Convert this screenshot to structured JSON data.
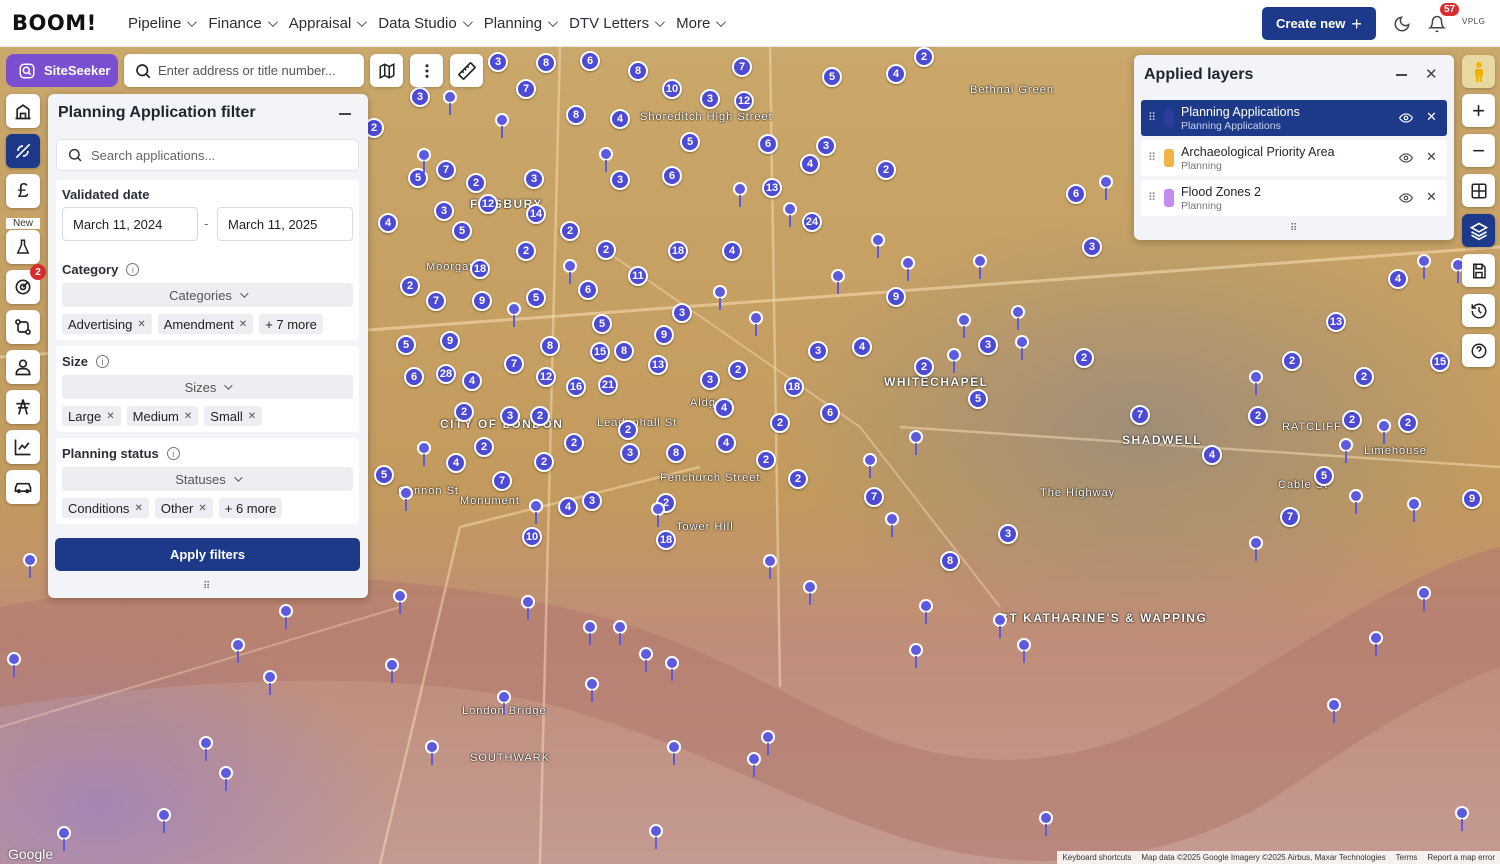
{
  "app": {
    "logo": "BOOM!"
  },
  "nav": {
    "items": [
      {
        "label": "Pipeline"
      },
      {
        "label": "Finance"
      },
      {
        "label": "Appraisal"
      },
      {
        "label": "Data Studio"
      },
      {
        "label": "Planning"
      },
      {
        "label": "DTV Letters"
      },
      {
        "label": "More"
      }
    ]
  },
  "header": {
    "create_label": "Create new",
    "notification_count": "57",
    "user_mark": "VPLG"
  },
  "toolbar": {
    "siteseeker_label": "SiteSeeker",
    "search_placeholder": "Enter address or title number..."
  },
  "sidebar": {
    "new_label": "New",
    "badge_count": "2"
  },
  "filter": {
    "title": "Planning Application filter",
    "search_placeholder": "Search applications...",
    "validated_date_label": "Validated date",
    "date_from": "March 11, 2024",
    "date_to": "March 11, 2025",
    "category_label": "Category",
    "category_dropdown": "Categories",
    "category_chips": [
      "Advertising",
      "Amendment"
    ],
    "category_more": "+ 7 more",
    "size_label": "Size",
    "size_dropdown": "Sizes",
    "size_chips": [
      "Large",
      "Medium",
      "Small"
    ],
    "status_label": "Planning status",
    "status_dropdown": "Statuses",
    "status_chips": [
      "Conditions",
      "Other"
    ],
    "status_more": "+ 6 more",
    "apply_label": "Apply filters"
  },
  "layers": {
    "title": "Applied layers",
    "items": [
      {
        "name": "Planning Applications",
        "sub": "Planning Applications",
        "color": "#2a3d9a"
      },
      {
        "name": "Archaeological Priority Area",
        "sub": "Planning",
        "color": "#f1b248"
      },
      {
        "name": "Flood Zones 2",
        "sub": "Planning",
        "color": "#c58cf0"
      }
    ]
  },
  "map": {
    "labels": [
      "FINSBURY",
      "WHITECHAPEL",
      "SHADWELL",
      "RATCLIFF",
      "ST KATHARINE'S & WAPPING",
      "CITY OF LONDON",
      "SOUTHWARK",
      "Moorgate",
      "Leadenhall St",
      "Cannon St",
      "Fenchurch Street",
      "Monument",
      "Aldgate",
      "Cable St",
      "The Highway",
      "Bethnal Green",
      "Shoreditch High Street",
      "Limehouse",
      "London Bridge",
      "Tower Hill"
    ],
    "clusters": [
      "3",
      "8",
      "6",
      "8",
      "7",
      "5",
      "4",
      "2",
      "7",
      "3",
      "12",
      "10",
      "3",
      "4",
      "8",
      "5",
      "3",
      "6",
      "2",
      "7",
      "5",
      "2",
      "3",
      "3",
      "6",
      "4",
      "2",
      "3",
      "12",
      "14",
      "5",
      "4",
      "2",
      "2",
      "2",
      "11",
      "18",
      "4",
      "13",
      "24",
      "2",
      "7",
      "9",
      "5",
      "6",
      "18",
      "5",
      "9",
      "3",
      "8",
      "8",
      "15",
      "9",
      "5",
      "6",
      "28",
      "4",
      "7",
      "12",
      "16",
      "21",
      "13",
      "3",
      "2",
      "18",
      "3",
      "4",
      "2",
      "3",
      "2",
      "2",
      "4",
      "2",
      "2",
      "2",
      "3",
      "8",
      "4",
      "2",
      "4",
      "2",
      "6",
      "5",
      "7",
      "4",
      "3",
      "2",
      "18",
      "10",
      "2",
      "7",
      "3",
      "8",
      "9",
      "2",
      "3",
      "5",
      "2",
      "3",
      "6",
      "7",
      "4",
      "2",
      "2",
      "13",
      "2",
      "4",
      "2",
      "2",
      "5",
      "7",
      "9",
      "15",
      "4",
      "6",
      "3",
      "2"
    ],
    "google": "Google",
    "attribution": [
      "Keyboard shortcuts",
      "Map data ©2025 Google Imagery ©2025 Airbus, Maxar Technologies",
      "Terms",
      "Report a map error"
    ]
  },
  "colors": {
    "accent": "#1d3a8a",
    "siteseeker": "#7b4fd1",
    "pin": "#4d4ad6",
    "badge": "#d92d2d"
  }
}
